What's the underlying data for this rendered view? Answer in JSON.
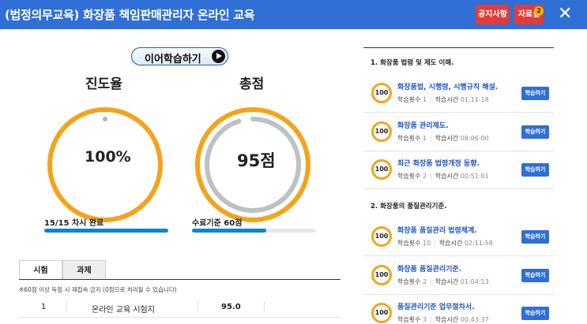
{
  "header": {
    "title": "(법정의무교육) 화장품 책임판매관리자 온라인 교육",
    "notice_label": "공지사항",
    "material_label": "자료실",
    "material_badge": "2",
    "close_icon": "close-icon"
  },
  "dashboard": {
    "continue_label": "이어학습하기",
    "progress_title": "진도율",
    "score_title": "총점",
    "progress_value": "100%",
    "progress_fraction": 1.0,
    "progress_caption": "15/15 차시 완료",
    "score_value": "95점",
    "score_fraction": 0.95,
    "score_caption": "수료기준 60점",
    "pass_fraction": 0.6,
    "accent_color": "#f5a31a",
    "bar_color": "#0e87c3"
  },
  "tabs": {
    "exam": "시험",
    "task": "과제"
  },
  "exam": {
    "notice": "※60점 이상 득점 시 재접속 금지 (0점으로 처리될 수 있습니다)",
    "rows": [
      {
        "num": "1",
        "name": "온라인 교육 시험지",
        "score": "95.0"
      }
    ]
  },
  "chapters": [
    {
      "title": "1. 화장품 법령 및 제도 이해."
    },
    {
      "title": "2. 화장품의 품질관리기준."
    }
  ],
  "lessons": [
    {
      "progress": "100",
      "name": "화장품법, 시행령, 시행규칙 해설.",
      "count_label": "학습횟수",
      "count": "1",
      "time_label": "학습시간",
      "time": "01:11:18",
      "button": "학습하기"
    },
    {
      "progress": "100",
      "name": "화장품 관리제도.",
      "count_label": "학습횟수",
      "count": "1",
      "time_label": "학습시간",
      "time": "08:06:00",
      "button": "학습하기"
    },
    {
      "progress": "100",
      "name": "최근 화장품 법령개정 동향.",
      "count_label": "학습횟수",
      "count": "2",
      "time_label": "학습시간",
      "time": "00:51:01",
      "button": "학습하기"
    },
    {
      "progress": "100",
      "name": "화장품 품질관리 법령체계.",
      "count_label": "학습횟수",
      "count": "10",
      "time_label": "학습시간",
      "time": "02:11:58",
      "button": "학습하기"
    },
    {
      "progress": "100",
      "name": "화장품 품질관리기준.",
      "count_label": "학습횟수",
      "count": "2",
      "time_label": "학습시간",
      "time": "01:04:13",
      "button": "학습하기"
    },
    {
      "progress": "100",
      "name": "품질관리기준 업무절차서.",
      "count_label": "학습횟수",
      "count": "3",
      "time_label": "학습시간",
      "time": "00:43:37",
      "button": "학습하기"
    }
  ]
}
